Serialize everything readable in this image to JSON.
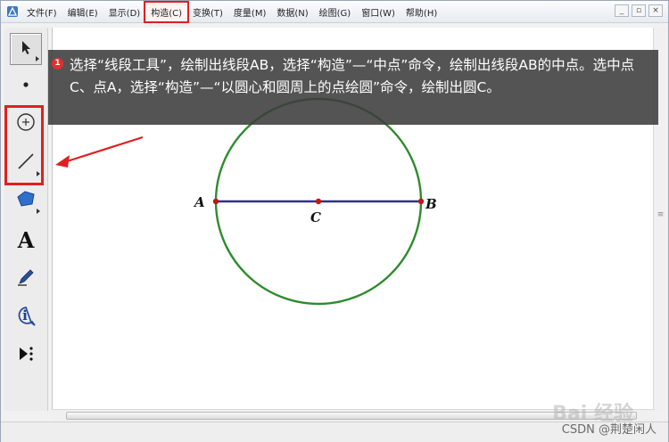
{
  "menu": {
    "items": [
      {
        "label": "文件(F)"
      },
      {
        "label": "编辑(E)"
      },
      {
        "label": "显示(D)"
      },
      {
        "label": "构造(C)",
        "active": true
      },
      {
        "label": "变换(T)"
      },
      {
        "label": "度量(M)"
      },
      {
        "label": "数据(N)"
      },
      {
        "label": "绘图(G)"
      },
      {
        "label": "窗口(W)"
      },
      {
        "label": "帮助(H)"
      }
    ]
  },
  "window_controls": {
    "minimize": "_",
    "restore": "▫",
    "close": "×"
  },
  "toolbox": {
    "tools": [
      {
        "name": "arrow-tool",
        "icon": "arrow-icon"
      },
      {
        "name": "point-tool",
        "icon": "point-icon"
      },
      {
        "name": "compass-tool",
        "icon": "circle-icon"
      },
      {
        "name": "segment-tool",
        "icon": "segment-icon"
      },
      {
        "name": "polygon-tool",
        "icon": "polygon-icon"
      },
      {
        "name": "text-tool",
        "icon": "text-icon",
        "glyph": "A"
      },
      {
        "name": "marker-tool",
        "icon": "pen-icon"
      },
      {
        "name": "info-tool",
        "icon": "info-icon",
        "glyph": "i"
      },
      {
        "name": "custom-tool",
        "icon": "custom-tool-icon"
      }
    ]
  },
  "callout": {
    "marker": "1",
    "text": "选择“线段工具”，绘制出线段AB，选择“构造”—“中点”命令，绘制出线段AB的中点。选中点C、点A，选择“构造”—“以圆心和圆周上的点绘圆”命令，绘制出圆C。"
  },
  "geometry": {
    "point_labels": {
      "A": "A",
      "B": "B",
      "C": "C"
    }
  },
  "colors": {
    "circle": "#2e8b2e",
    "segment": "#2f2f8f",
    "point": "#c0161a",
    "highlight": "#e02020"
  },
  "scrollbar": {
    "grip": "≡"
  },
  "watermark": {
    "brand": "Bai 经验",
    "credit": "CSDN @荆楚闲人"
  }
}
